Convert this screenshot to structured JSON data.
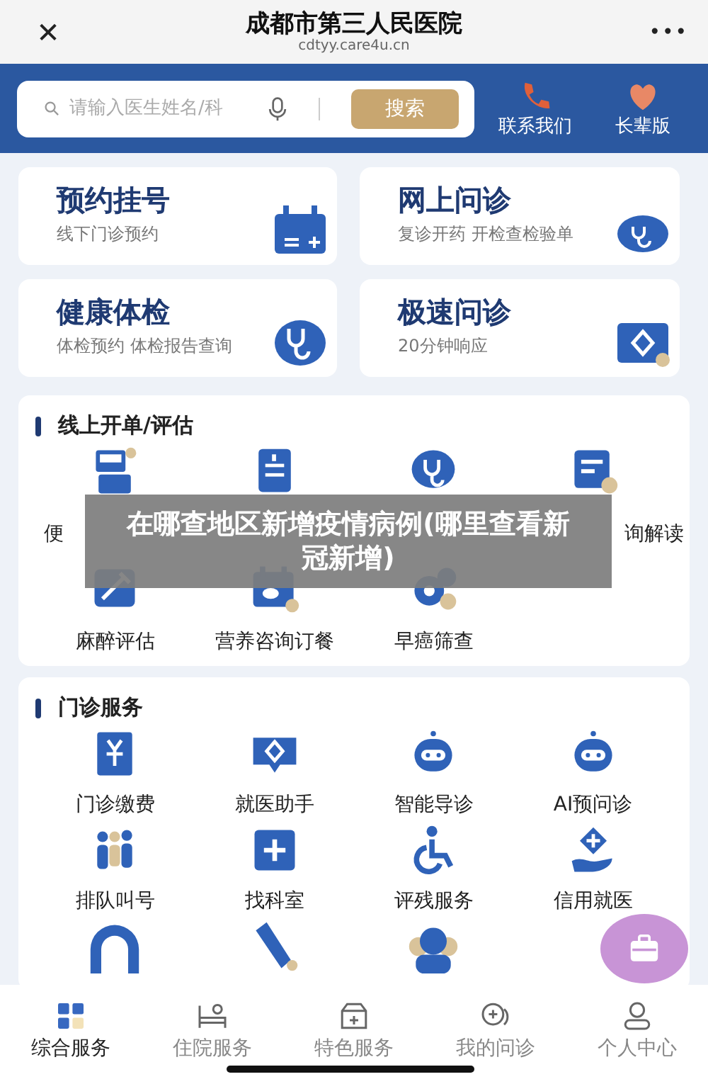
{
  "header": {
    "close": "✕",
    "title": "成都市第三人民医院",
    "url": "cdtyy.care4u.cn",
    "more": "•••"
  },
  "search": {
    "placeholder": "请输入医生姓名/科",
    "button": "搜索"
  },
  "quick_links": [
    {
      "label": "联系我们"
    },
    {
      "label": "长辈版"
    }
  ],
  "feature_cards": [
    {
      "title": "预约挂号",
      "subtitle": "线下门诊预约"
    },
    {
      "title": "网上问诊",
      "subtitle": "复诊开药 开检查检验单"
    },
    {
      "title": "健康体检",
      "subtitle": "体检预约 体检报告查询"
    },
    {
      "title": "极速问诊",
      "subtitle": "20分钟响应"
    }
  ],
  "sections": [
    {
      "title": "线上开单/评估",
      "items": [
        {
          "kind": "labeled",
          "label": "便"
        },
        {
          "kind": "covered"
        },
        {
          "kind": "covered"
        },
        {
          "kind": "labeled",
          "label": "询解读"
        },
        {
          "kind": "labeled",
          "label": "麻醉评估"
        },
        {
          "kind": "labeled",
          "label": "营养咨询订餐"
        },
        {
          "kind": "labeled",
          "label": "早癌筛查"
        }
      ]
    },
    {
      "title": "门诊服务",
      "items": [
        {
          "kind": "labeled",
          "label": "门诊缴费"
        },
        {
          "kind": "labeled",
          "label": "就医助手"
        },
        {
          "kind": "labeled",
          "label": "智能导诊"
        },
        {
          "kind": "labeled",
          "label": "AI预问诊"
        },
        {
          "kind": "labeled",
          "label": "排队叫号"
        },
        {
          "kind": "labeled",
          "label": "找科室"
        },
        {
          "kind": "labeled",
          "label": "评残服务"
        },
        {
          "kind": "labeled",
          "label": "信用就医"
        }
      ]
    }
  ],
  "overlay_caption": "在哪查地区新增疫情病例(哪里查看新冠新增)",
  "tabs": [
    {
      "label": "综合服务",
      "selected": true
    },
    {
      "label": "住院服务",
      "selected": false
    },
    {
      "label": "特色服务",
      "selected": false
    },
    {
      "label": "我的问诊",
      "selected": false
    },
    {
      "label": "个人中心",
      "selected": false
    }
  ]
}
